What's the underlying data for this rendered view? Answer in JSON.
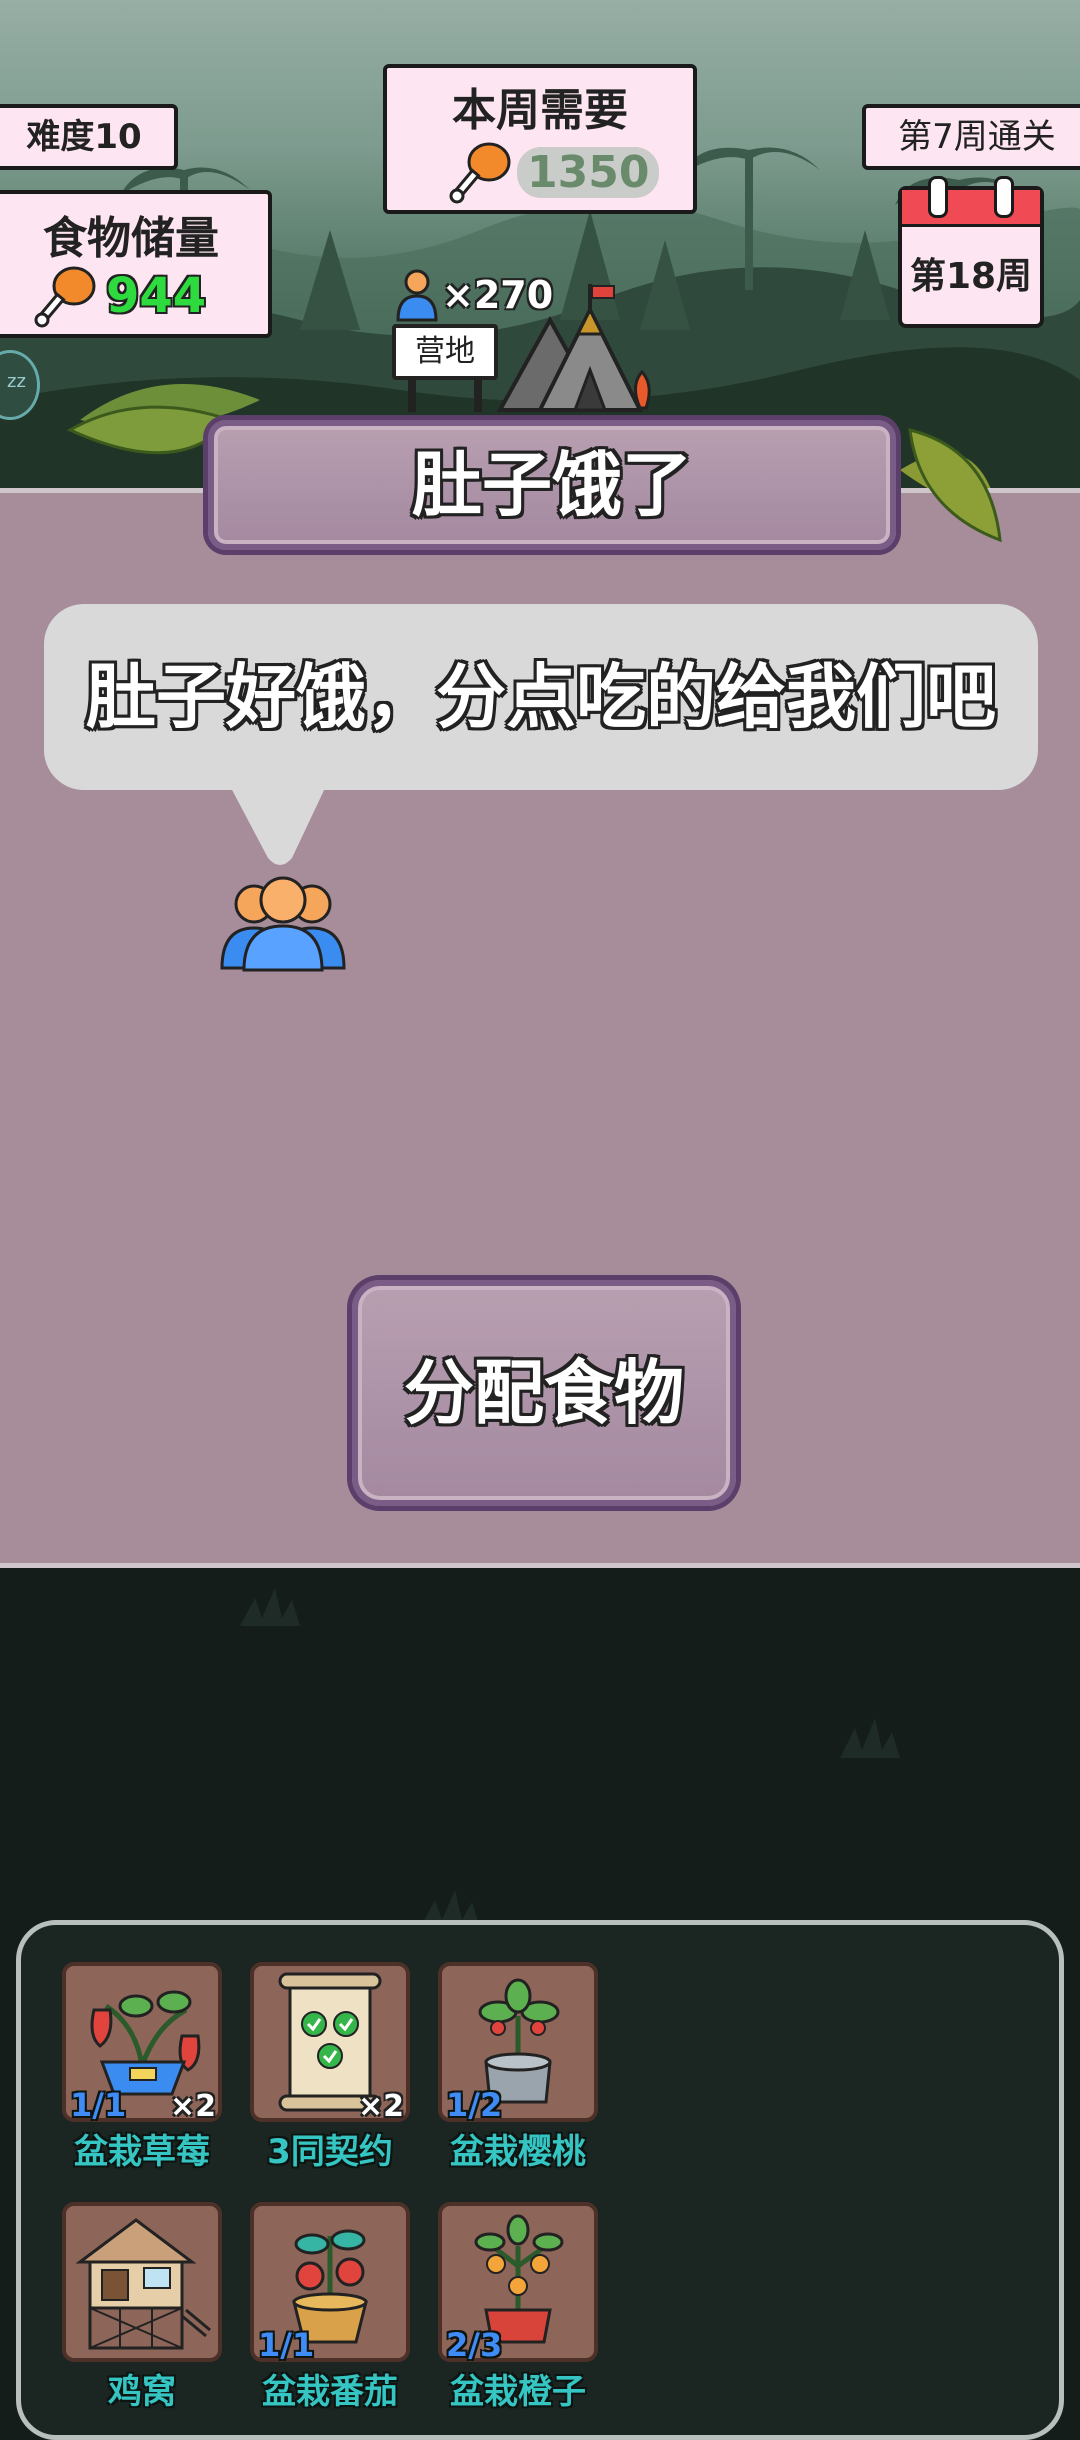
{
  "header": {
    "difficulty": "难度10",
    "food_storage_label": "食物储量",
    "food_storage_value": "944",
    "weekly_need_label": "本周需要",
    "weekly_need_value": "1350",
    "clear_week": "第7周通关",
    "current_week": "第18周",
    "population": "×270",
    "camp_label": "营地"
  },
  "event": {
    "title": "肚子饿了",
    "speech": "肚子好饿，分点吃的给我们吧",
    "action_button": "分配食物"
  },
  "inventory": {
    "items": [
      {
        "name": "盆栽草莓",
        "count": "1/1",
        "mult": "×2",
        "icon": "strawberry-plant-icon"
      },
      {
        "name": "3同契约",
        "count": "",
        "mult": "×2",
        "icon": "contract-scroll-icon"
      },
      {
        "name": "盆栽樱桃",
        "count": "1/2",
        "mult": "",
        "icon": "cherry-plant-icon"
      },
      {
        "name": "鸡窝",
        "count": "",
        "mult": "",
        "icon": "chicken-coop-icon"
      },
      {
        "name": "盆栽番茄",
        "count": "1/1",
        "mult": "",
        "icon": "tomato-plant-icon"
      },
      {
        "name": "盆栽橙子",
        "count": "2/3",
        "mult": "",
        "icon": "orange-plant-icon"
      }
    ]
  },
  "colors": {
    "card_bg": "#fde6f1",
    "food_value": "#2ddb3e",
    "panel_bg": "#a68d99",
    "label_teal": "#35c5c2",
    "count_blue": "#3f8cf7"
  }
}
